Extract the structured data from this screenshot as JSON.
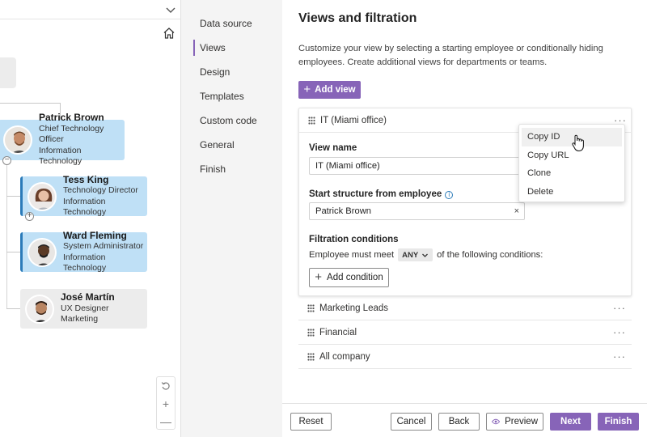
{
  "chart": {
    "cards": [
      {
        "name": "Patrick Brown",
        "title": "Chief Technology Officer",
        "dept": "Information Technology"
      },
      {
        "name": "Tess King",
        "title": "Technology Director",
        "dept": "Information Technology"
      },
      {
        "name": "Ward Fleming",
        "title": "System Administrator",
        "dept": "Information Technology"
      },
      {
        "name": "José Martín",
        "title": "UX Designer",
        "dept": "Marketing"
      }
    ],
    "collapse_symbol": "−",
    "expand_symbol": "+",
    "zoom": {
      "reset_icon": "rotate-ccw-icon",
      "in_symbol": "+",
      "out_symbol": "—"
    }
  },
  "nav": {
    "items": [
      "Data source",
      "Views",
      "Design",
      "Templates",
      "Custom code",
      "General",
      "Finish"
    ],
    "active": "Views"
  },
  "main": {
    "title": "Views and filtration",
    "description": "Customize your view by selecting a starting employee or conditionally hiding employees. Create additional views for departments or teams.",
    "add_view_label": "Add view",
    "add_view_symbol": "+",
    "expanded_view": {
      "name": "IT (Miami office)",
      "view_name_label": "View name",
      "view_name_value": "IT (Miami office)",
      "start_label": "Start structure from employee",
      "start_value": "Patrick Brown",
      "clear_symbol": "×",
      "filtration_label": "Filtration conditions",
      "condition_prefix": "Employee must meet",
      "condition_select": "ANY",
      "condition_suffix": "of the following conditions:",
      "add_condition_label": "Add condition",
      "add_condition_symbol": "+"
    },
    "other_views": [
      "Marketing Leads",
      "Financial",
      "All company"
    ],
    "more_symbol": "···"
  },
  "context_menu": {
    "items": [
      "Copy ID",
      "Copy URL",
      "Clone",
      "Delete"
    ],
    "hovered": "Copy ID"
  },
  "footer": {
    "reset": "Reset",
    "cancel": "Cancel",
    "back": "Back",
    "preview": "Preview",
    "next": "Next",
    "finish": "Finish"
  },
  "colors": {
    "accent": "#8764b8",
    "card_selected": "#bfe0f6",
    "card_default": "#ececec",
    "card_border": "#2b7bb9"
  }
}
